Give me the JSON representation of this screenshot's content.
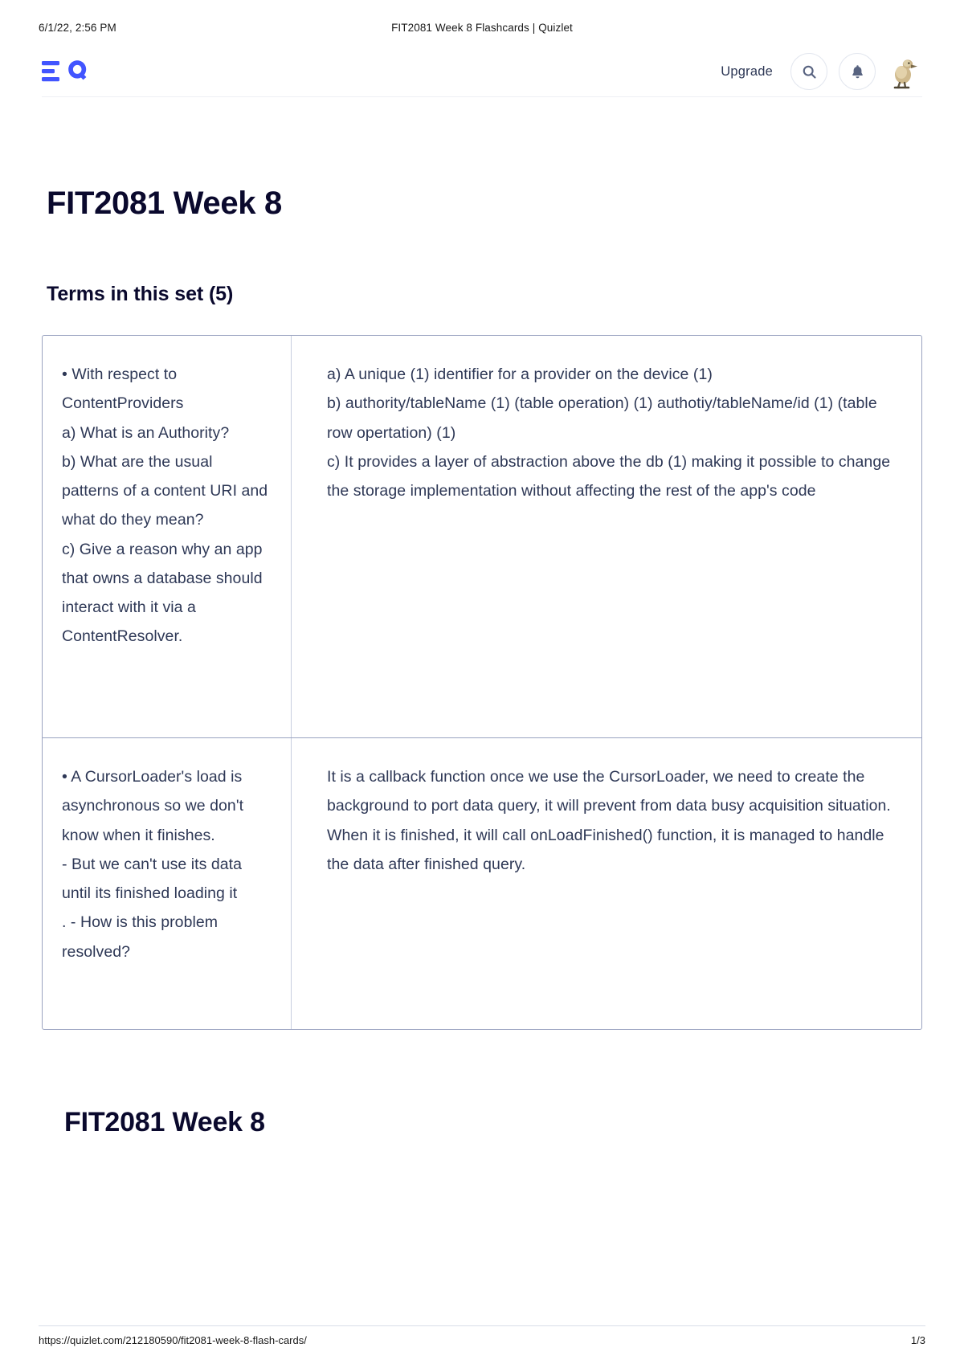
{
  "print_header": {
    "date": "6/1/22, 2:56 PM",
    "title": "FIT2081 Week 8 Flashcards | Quizlet"
  },
  "nav": {
    "logo_name": "quizlet-logo",
    "logo_color": "#4255FF",
    "upgrade_label": "Upgrade",
    "search_icon": "search-icon",
    "notifications_icon": "bell-icon",
    "avatar_label": "duckling-avatar"
  },
  "main": {
    "set_title": "FIT2081 Week 8",
    "terms_heading": "Terms in this set (5)",
    "bottom_title": "FIT2081 Week 8"
  },
  "cards": [
    {
      "term": "• With respect to ContentProviders\na) What is an Authority?\nb) What are the usual patterns of a content URI and what do they mean?\nc) Give a reason why an app that owns a database should interact with it via a ContentResolver.",
      "definition": "a) A unique (1) identifier for a provider on the device (1)\nb) authority/tableName (1) (table operation) (1) authotiy/tableName/id (1) (table row opertation) (1)\nc) It provides a layer of abstraction above the db (1) making it possible to change the storage implementation without affecting the rest of the app's code"
    },
    {
      "term": "• A CursorLoader's load is asynchronous so we don't know when it finishes.\n- But we can't use its data until its finished loading it\n. - How is this problem resolved?",
      "definition": "It is a callback function once we use the CursorLoader, we need to create the background to port data query, it will prevent from data busy acquisition situation. When it is finished, it will call onLoadFinished() function, it is managed to handle the data after finished query."
    }
  ],
  "print_footer": {
    "url": "https://quizlet.com/212180590/fit2081-week-8-flash-cards/",
    "page": "1/3"
  }
}
